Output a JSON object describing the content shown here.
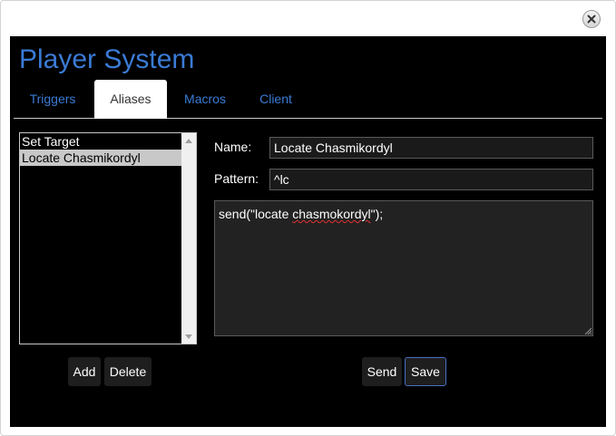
{
  "window": {
    "title": "Player System",
    "close_icon": "close-icon"
  },
  "tabs": [
    {
      "label": "Triggers",
      "active": false
    },
    {
      "label": "Aliases",
      "active": true
    },
    {
      "label": "Macros",
      "active": false
    },
    {
      "label": "Client",
      "active": false
    }
  ],
  "aliases": {
    "items": [
      {
        "label": "Set Target",
        "selected": false
      },
      {
        "label": "Locate Chasmikordyl",
        "selected": true
      }
    ],
    "add_label": "Add",
    "delete_label": "Delete"
  },
  "editor": {
    "name_label": "Name:",
    "name_value": "Locate Chasmikordyl",
    "pattern_label": "Pattern:",
    "pattern_value": "^lc",
    "code_prefix": "send(\"locate ",
    "code_misspelled": "chasmokordyl",
    "code_suffix": "\");",
    "send_label": "Send",
    "save_label": "Save"
  },
  "colors": {
    "accent": "#3a7bd5",
    "panel_background": "#000000",
    "selection": "#c8c8c8",
    "focus_border": "#4a6fc0"
  }
}
